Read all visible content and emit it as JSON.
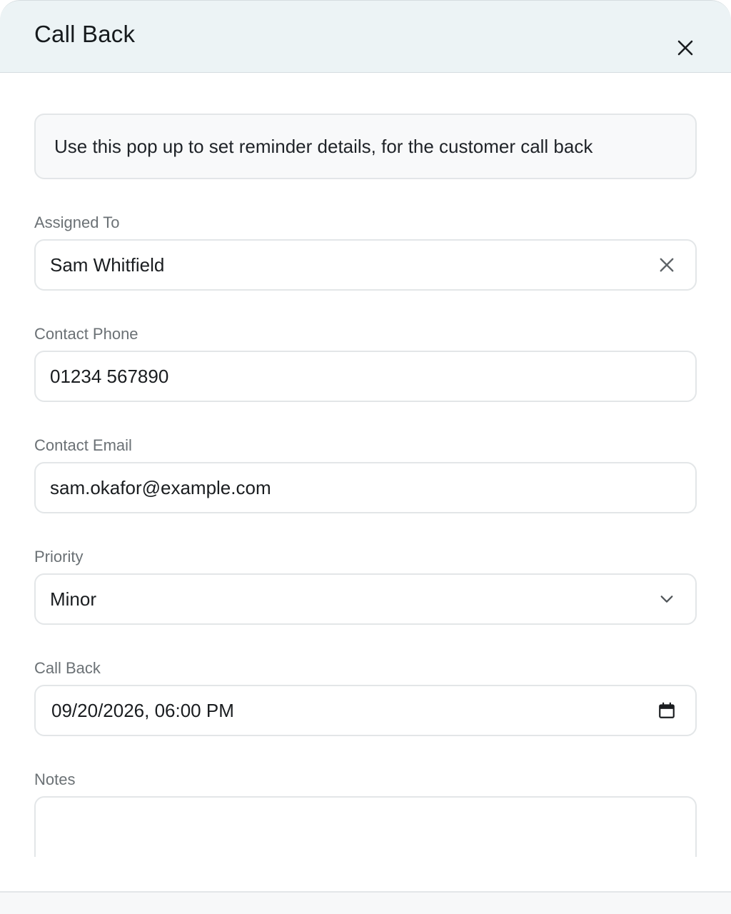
{
  "dialog": {
    "title": "Call Back",
    "close_icon": "close-icon"
  },
  "info": {
    "text": "Use this pop up to set reminder details, for the customer call back"
  },
  "form": {
    "assigned_to": {
      "label": "Assigned To",
      "value": "Sam Whitfield",
      "clear_icon": "clear-icon"
    },
    "contact_phone": {
      "label": "Contact Phone",
      "value": "01234 567890"
    },
    "contact_email": {
      "label": "Contact Email",
      "value": "sam.okafor@example.com"
    },
    "priority": {
      "label": "Priority",
      "value": "Minor",
      "icon": "chevron-down-icon"
    },
    "call_back": {
      "label": "Call Back",
      "value": "09/20/2026, 06:00 PM",
      "icon": "calendar-icon"
    },
    "notes": {
      "label": "Notes",
      "value": ""
    }
  },
  "colors": {
    "header_bg": "#ecf3f5",
    "border": "#e3e6e8",
    "label": "#6b7175"
  }
}
